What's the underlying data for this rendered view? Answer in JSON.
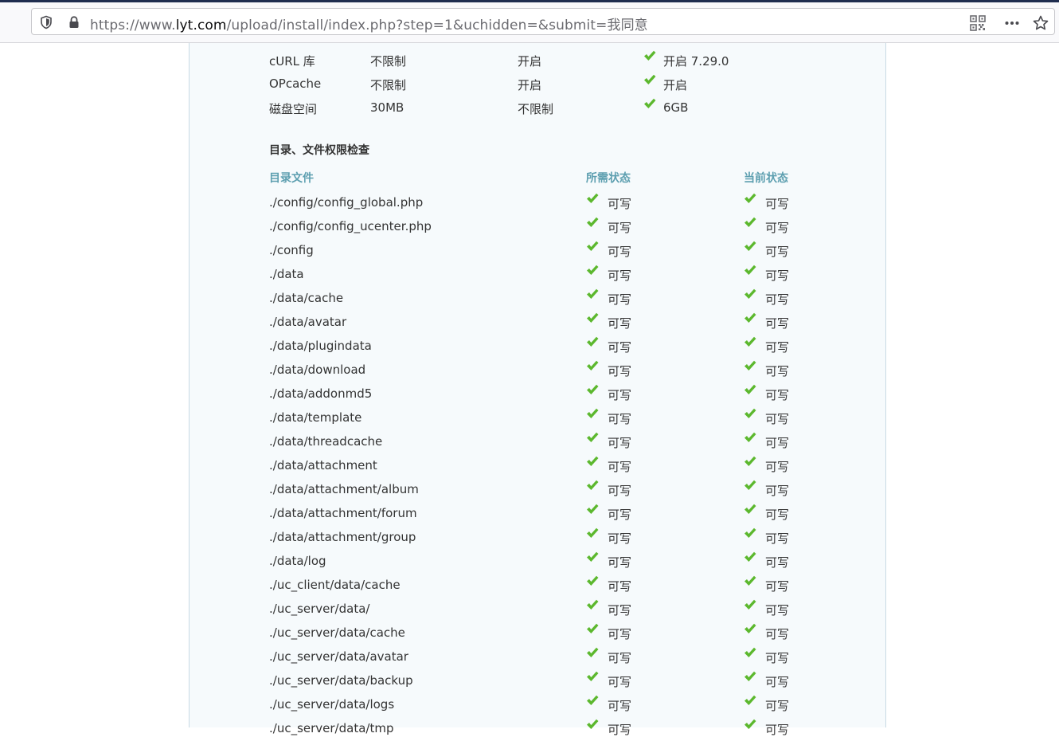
{
  "browser": {
    "url_scheme_host_prefix": "https://www.",
    "url_domain": "lyt.com",
    "url_path": "/upload/install/index.php?step=1&uchidden=&submit=我同意"
  },
  "env_rows": [
    {
      "name": "cURL 库",
      "required": "不限制",
      "recommended": "开启",
      "current": "开启 7.29.0"
    },
    {
      "name": "OPcache",
      "required": "不限制",
      "recommended": "开启",
      "current": "开启"
    },
    {
      "name": "磁盘空间",
      "required": "30MB",
      "recommended": "不限制",
      "current": "6GB"
    }
  ],
  "dir_check": {
    "title": "目录、文件权限检查",
    "headers": {
      "file": "目录文件",
      "required": "所需状态",
      "current": "当前状态"
    },
    "rows": [
      {
        "path": "./config/config_global.php",
        "required": "可写",
        "current": "可写"
      },
      {
        "path": "./config/config_ucenter.php",
        "required": "可写",
        "current": "可写"
      },
      {
        "path": "./config",
        "required": "可写",
        "current": "可写"
      },
      {
        "path": "./data",
        "required": "可写",
        "current": "可写"
      },
      {
        "path": "./data/cache",
        "required": "可写",
        "current": "可写"
      },
      {
        "path": "./data/avatar",
        "required": "可写",
        "current": "可写"
      },
      {
        "path": "./data/plugindata",
        "required": "可写",
        "current": "可写"
      },
      {
        "path": "./data/download",
        "required": "可写",
        "current": "可写"
      },
      {
        "path": "./data/addonmd5",
        "required": "可写",
        "current": "可写"
      },
      {
        "path": "./data/template",
        "required": "可写",
        "current": "可写"
      },
      {
        "path": "./data/threadcache",
        "required": "可写",
        "current": "可写"
      },
      {
        "path": "./data/attachment",
        "required": "可写",
        "current": "可写"
      },
      {
        "path": "./data/attachment/album",
        "required": "可写",
        "current": "可写"
      },
      {
        "path": "./data/attachment/forum",
        "required": "可写",
        "current": "可写"
      },
      {
        "path": "./data/attachment/group",
        "required": "可写",
        "current": "可写"
      },
      {
        "path": "./data/log",
        "required": "可写",
        "current": "可写"
      },
      {
        "path": "./uc_client/data/cache",
        "required": "可写",
        "current": "可写"
      },
      {
        "path": "./uc_server/data/",
        "required": "可写",
        "current": "可写"
      },
      {
        "path": "./uc_server/data/cache",
        "required": "可写",
        "current": "可写"
      },
      {
        "path": "./uc_server/data/avatar",
        "required": "可写",
        "current": "可写"
      },
      {
        "path": "./uc_server/data/backup",
        "required": "可写",
        "current": "可写"
      },
      {
        "path": "./uc_server/data/logs",
        "required": "可写",
        "current": "可写"
      },
      {
        "path": "./uc_server/data/tmp",
        "required": "可写",
        "current": "可写"
      }
    ]
  },
  "colors": {
    "header_accent": "#5d9fb0",
    "check_green": "#5cb82e",
    "panel_bg": "#f6fafc"
  },
  "icons": {
    "shield": "shield-icon",
    "lock": "lock-icon",
    "qr": "qr-code-icon",
    "more": "more-dots-icon",
    "bookmark": "bookmark-star-icon",
    "check": "check-icon"
  }
}
